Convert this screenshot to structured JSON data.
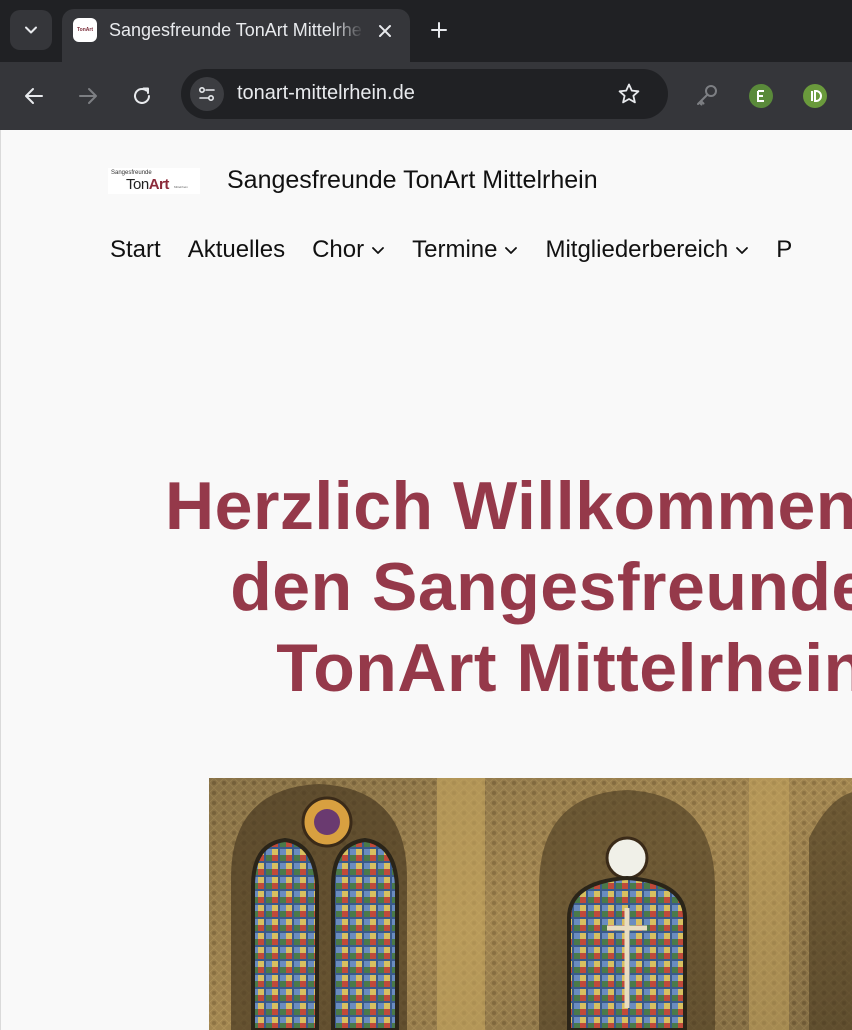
{
  "browser": {
    "tab_title": "Sangesfreunde TonArt Mittelrhein",
    "favicon_text": "TonArt",
    "url": "tonart-mittelrhein.de",
    "icons": [
      "tab-search-icon",
      "close-icon",
      "plus-icon",
      "back-icon",
      "forward-icon",
      "reload-icon",
      "site-settings-icon",
      "star-icon",
      "key-icon",
      "extension-icon",
      "extension-icon"
    ]
  },
  "site": {
    "logo": {
      "small": "Sangesfreunde",
      "ton": "Ton",
      "art": "Art",
      "tiny": "Mittelrhein"
    },
    "title": "Sangesfreunde TonArt Mittelrhein",
    "nav": [
      {
        "label": "Start",
        "dropdown": false
      },
      {
        "label": "Aktuelles",
        "dropdown": false
      },
      {
        "label": "Chor",
        "dropdown": true
      },
      {
        "label": "Termine",
        "dropdown": true
      },
      {
        "label": "Mitgliederbereich",
        "dropdown": true
      },
      {
        "label": "P",
        "dropdown": false
      }
    ],
    "headline": [
      "Herzlich Willkommen bei",
      "den Sangesfreunden",
      "TonArt Mittelrhein"
    ],
    "hero_image": "church-interior-stained-glass",
    "colors": {
      "accent": "#95394a",
      "logo_accent": "#8b2a3a"
    }
  }
}
